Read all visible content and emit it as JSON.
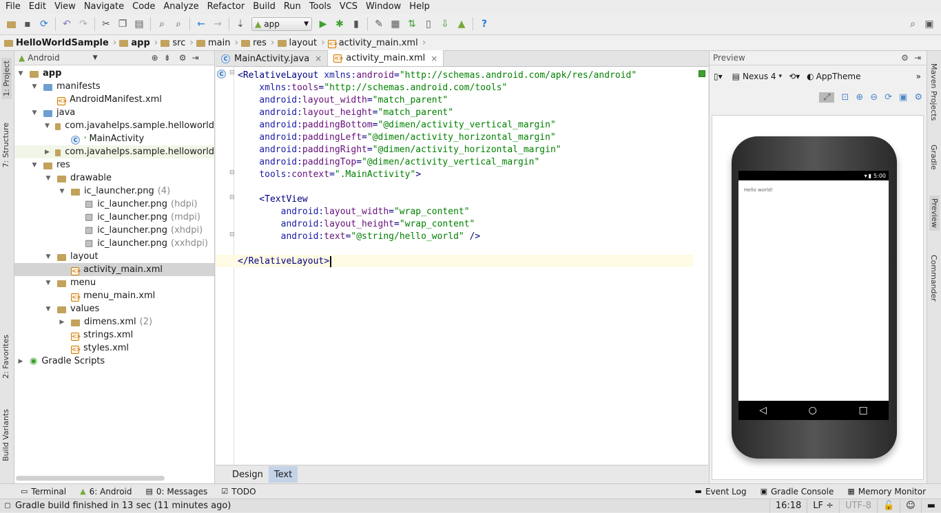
{
  "menu": [
    "File",
    "Edit",
    "View",
    "Navigate",
    "Code",
    "Analyze",
    "Refactor",
    "Build",
    "Run",
    "Tools",
    "VCS",
    "Window",
    "Help"
  ],
  "toolbar": {
    "run_config": "app",
    "help": "?"
  },
  "breadcrumbs": [
    "HelloWorldSample",
    "app",
    "src",
    "main",
    "res",
    "layout",
    "activity_main.xml"
  ],
  "left_tabs": {
    "project": "1: Project",
    "structure": "7: Structure",
    "favorites": "2: Favorites",
    "build_variants": "Build Variants"
  },
  "right_tabs": {
    "maven": "Maven Projects",
    "gradle": "Gradle",
    "preview": "Preview",
    "commander": "Commander"
  },
  "project_panel": {
    "view_mode": "Android"
  },
  "tree": [
    {
      "label": "app",
      "count": "",
      "indent": 0,
      "icon": "folder",
      "expanded": true
    },
    {
      "label": "manifests",
      "count": "",
      "indent": 1,
      "icon": "folder-blue",
      "expanded": true
    },
    {
      "label": "AndroidManifest.xml",
      "count": "",
      "indent": 2,
      "icon": "xml"
    },
    {
      "label": "java",
      "count": "",
      "indent": 1,
      "icon": "folder-blue",
      "expanded": true
    },
    {
      "label": "com.javahelps.sample.helloworld",
      "count": "",
      "indent": 2,
      "icon": "package",
      "expanded": true
    },
    {
      "label": "MainActivity",
      "count": "",
      "indent": 3,
      "icon": "class"
    },
    {
      "label": "com.javahelps.sample.helloworld",
      "count": "",
      "indent": 2,
      "icon": "package",
      "expanded": false
    },
    {
      "label": "res",
      "count": "",
      "indent": 1,
      "icon": "folder",
      "expanded": true
    },
    {
      "label": "drawable",
      "count": "",
      "indent": 2,
      "icon": "folder",
      "expanded": true
    },
    {
      "label": "ic_launcher.png",
      "count": "(4)",
      "indent": 3,
      "icon": "folder",
      "expanded": true
    },
    {
      "label": "ic_launcher.png",
      "count": "(hdpi)",
      "indent": 4,
      "icon": "image"
    },
    {
      "label": "ic_launcher.png",
      "count": "(mdpi)",
      "indent": 4,
      "icon": "image"
    },
    {
      "label": "ic_launcher.png",
      "count": "(xhdpi)",
      "indent": 4,
      "icon": "image"
    },
    {
      "label": "ic_launcher.png",
      "count": "(xxhdpi)",
      "indent": 4,
      "icon": "image"
    },
    {
      "label": "layout",
      "count": "",
      "indent": 2,
      "icon": "folder",
      "expanded": true
    },
    {
      "label": "activity_main.xml",
      "count": "",
      "indent": 3,
      "icon": "xml",
      "selected": true
    },
    {
      "label": "menu",
      "count": "",
      "indent": 2,
      "icon": "folder",
      "expanded": true
    },
    {
      "label": "menu_main.xml",
      "count": "",
      "indent": 3,
      "icon": "xml"
    },
    {
      "label": "values",
      "count": "",
      "indent": 2,
      "icon": "folder",
      "expanded": true
    },
    {
      "label": "dimens.xml",
      "count": "(2)",
      "indent": 3,
      "icon": "folder",
      "expanded": false
    },
    {
      "label": "strings.xml",
      "count": "",
      "indent": 3,
      "icon": "xml"
    },
    {
      "label": "styles.xml",
      "count": "",
      "indent": 3,
      "icon": "xml"
    },
    {
      "label": "Gradle Scripts",
      "count": "",
      "indent": 0,
      "icon": "gradle",
      "expanded": false
    }
  ],
  "editor_tabs": [
    {
      "label": "MainActivity.java",
      "active": false
    },
    {
      "label": "activity_main.xml",
      "active": true
    }
  ],
  "code": [
    {
      "line": 1,
      "parts": [
        [
          "tag",
          "<RelativeLayout "
        ],
        [
          "ns",
          "xmlns:"
        ],
        [
          "attr",
          "android"
        ],
        [
          "tag",
          "="
        ],
        [
          "val",
          "\"http://schemas.android.com/apk/res/android\""
        ]
      ]
    },
    {
      "line": 2,
      "parts": [
        [
          "ns",
          "    xmlns:"
        ],
        [
          "attr",
          "tools"
        ],
        [
          "tag",
          "="
        ],
        [
          "val",
          "\"http://schemas.android.com/tools\""
        ]
      ]
    },
    {
      "line": 3,
      "parts": [
        [
          "ns",
          "    android:"
        ],
        [
          "attr",
          "layout_width"
        ],
        [
          "tag",
          "="
        ],
        [
          "val",
          "\"match_parent\""
        ]
      ]
    },
    {
      "line": 4,
      "parts": [
        [
          "ns",
          "    android:"
        ],
        [
          "attr",
          "layout_height"
        ],
        [
          "tag",
          "="
        ],
        [
          "val",
          "\"match_parent\""
        ]
      ]
    },
    {
      "line": 5,
      "parts": [
        [
          "ns",
          "    android:"
        ],
        [
          "attr",
          "paddingBottom"
        ],
        [
          "tag",
          "="
        ],
        [
          "val",
          "\"@dimen/activity_vertical_margin\""
        ]
      ]
    },
    {
      "line": 6,
      "parts": [
        [
          "ns",
          "    android:"
        ],
        [
          "attr",
          "paddingLeft"
        ],
        [
          "tag",
          "="
        ],
        [
          "val",
          "\"@dimen/activity_horizontal_margin\""
        ]
      ]
    },
    {
      "line": 7,
      "parts": [
        [
          "ns",
          "    android:"
        ],
        [
          "attr",
          "paddingRight"
        ],
        [
          "tag",
          "="
        ],
        [
          "val",
          "\"@dimen/activity_horizontal_margin\""
        ]
      ]
    },
    {
      "line": 8,
      "parts": [
        [
          "ns",
          "    android:"
        ],
        [
          "attr",
          "paddingTop"
        ],
        [
          "tag",
          "="
        ],
        [
          "val",
          "\"@dimen/activity_vertical_margin\""
        ]
      ]
    },
    {
      "line": 9,
      "parts": [
        [
          "ns",
          "    tools:"
        ],
        [
          "attr",
          "context"
        ],
        [
          "tag",
          "="
        ],
        [
          "val",
          "\".MainActivity\""
        ],
        [
          "tag",
          ">"
        ]
      ]
    },
    {
      "line": 10,
      "parts": []
    },
    {
      "line": 11,
      "parts": [
        [
          "tag",
          "    <TextView"
        ]
      ]
    },
    {
      "line": 12,
      "parts": [
        [
          "ns",
          "        android:"
        ],
        [
          "attr",
          "layout_width"
        ],
        [
          "tag",
          "="
        ],
        [
          "val",
          "\"wrap_content\""
        ]
      ]
    },
    {
      "line": 13,
      "parts": [
        [
          "ns",
          "        android:"
        ],
        [
          "attr",
          "layout_height"
        ],
        [
          "tag",
          "="
        ],
        [
          "val",
          "\"wrap_content\""
        ]
      ]
    },
    {
      "line": 14,
      "parts": [
        [
          "ns",
          "        android:"
        ],
        [
          "attr",
          "text"
        ],
        [
          "tag",
          "="
        ],
        [
          "val",
          "\"@string/hello_world\""
        ],
        [
          "tag",
          " />"
        ]
      ]
    },
    {
      "line": 15,
      "parts": []
    },
    {
      "line": 16,
      "parts": [
        [
          "tag",
          "</RelativeLayout>"
        ]
      ]
    }
  ],
  "design_tabs": [
    {
      "label": "Design",
      "active": false
    },
    {
      "label": "Text",
      "active": true
    }
  ],
  "preview": {
    "title": "Preview",
    "device": "Nexus 4",
    "theme": "AppTheme",
    "status_time": "5:00",
    "app_text": "Hello world!"
  },
  "bottom_tools": [
    {
      "label": "Terminal",
      "icon": "terminal-icon"
    },
    {
      "label": "6: Android",
      "icon": "android-icon"
    },
    {
      "label": "0: Messages",
      "icon": "messages-icon"
    },
    {
      "label": "TODO",
      "icon": "todo-icon"
    }
  ],
  "bottom_tools_right": [
    {
      "label": "Event Log",
      "icon": "event-log-icon"
    },
    {
      "label": "Gradle Console",
      "icon": "gradle-console-icon"
    },
    {
      "label": "Memory Monitor",
      "icon": "memory-monitor-icon"
    }
  ],
  "status": {
    "message": "Gradle build finished in 13 sec (11 minutes ago)",
    "position": "16:18",
    "line_sep": "LF ÷",
    "encoding": "UTF-8"
  },
  "colors": {
    "accent": "#4a86c8",
    "selection": "#d4d4d4",
    "caret_line": "#fffae3"
  }
}
